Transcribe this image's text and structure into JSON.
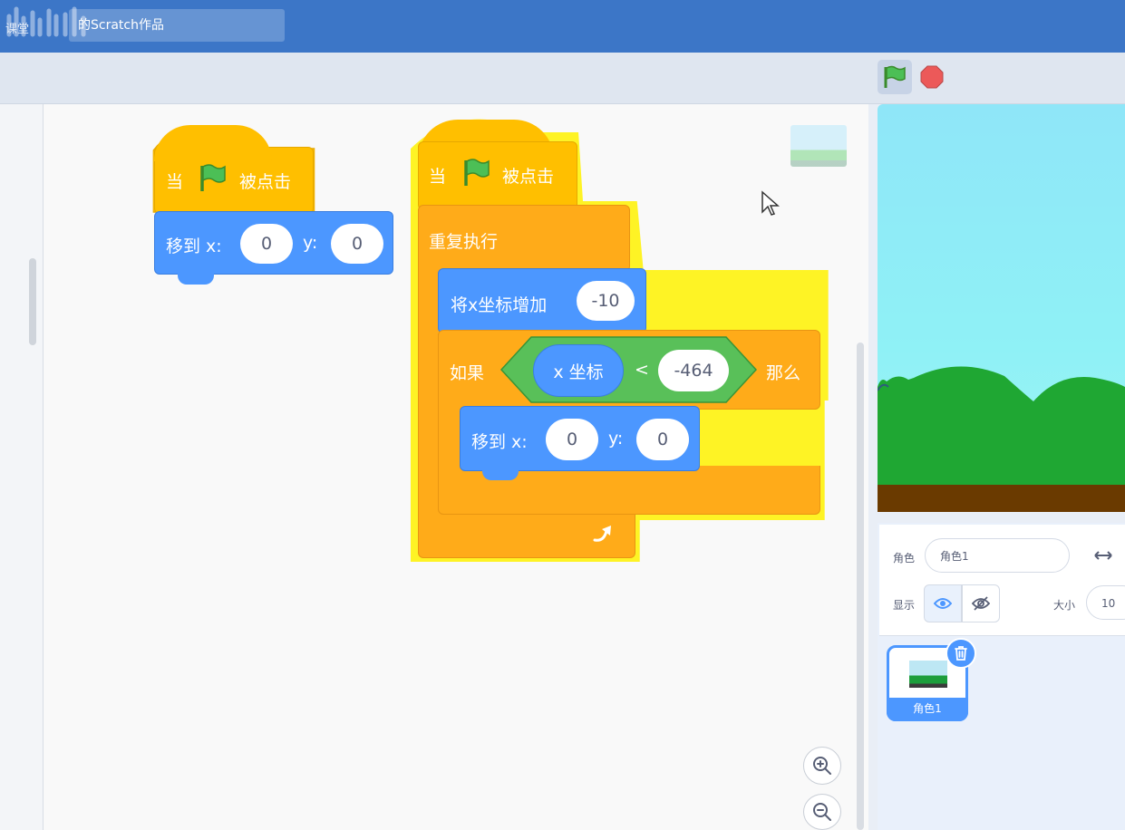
{
  "menubar": {
    "logo_text": "课堂",
    "project_title": "的Scratch作品"
  },
  "controls": {
    "green_flag": "green-flag-icon",
    "stop": "stop-icon"
  },
  "scripts": {
    "script1": {
      "hat_when": "当",
      "hat_clicked": "被点击",
      "goto_label": "移到 x:",
      "goto_x": "0",
      "goto_y_label": "y:",
      "goto_y": "0"
    },
    "script2": {
      "hat_when": "当",
      "hat_clicked": "被点击",
      "forever_label": "重复执行",
      "change_x_label": "将x坐标增加",
      "change_x_value": "-10",
      "if_label": "如果",
      "x_position_label": "x 坐标",
      "lt_operator": "<",
      "compare_value": "-464",
      "then_label": "那么",
      "goto_label": "移到 x:",
      "goto_x": "0",
      "goto_y_label": "y:",
      "goto_y": "0"
    }
  },
  "sprite_info": {
    "sprite_label": "角色",
    "sprite_name": "角色1",
    "show_label": "显示",
    "size_label": "大小",
    "size_value": "10"
  },
  "sprite_list": [
    {
      "name": "角色1"
    }
  ],
  "colors": {
    "menubar": "#3c76c7",
    "events": "#ffbf00",
    "control": "#ffab19",
    "motion": "#4c97ff",
    "operators": "#59c059",
    "highlight": "#fff200"
  }
}
